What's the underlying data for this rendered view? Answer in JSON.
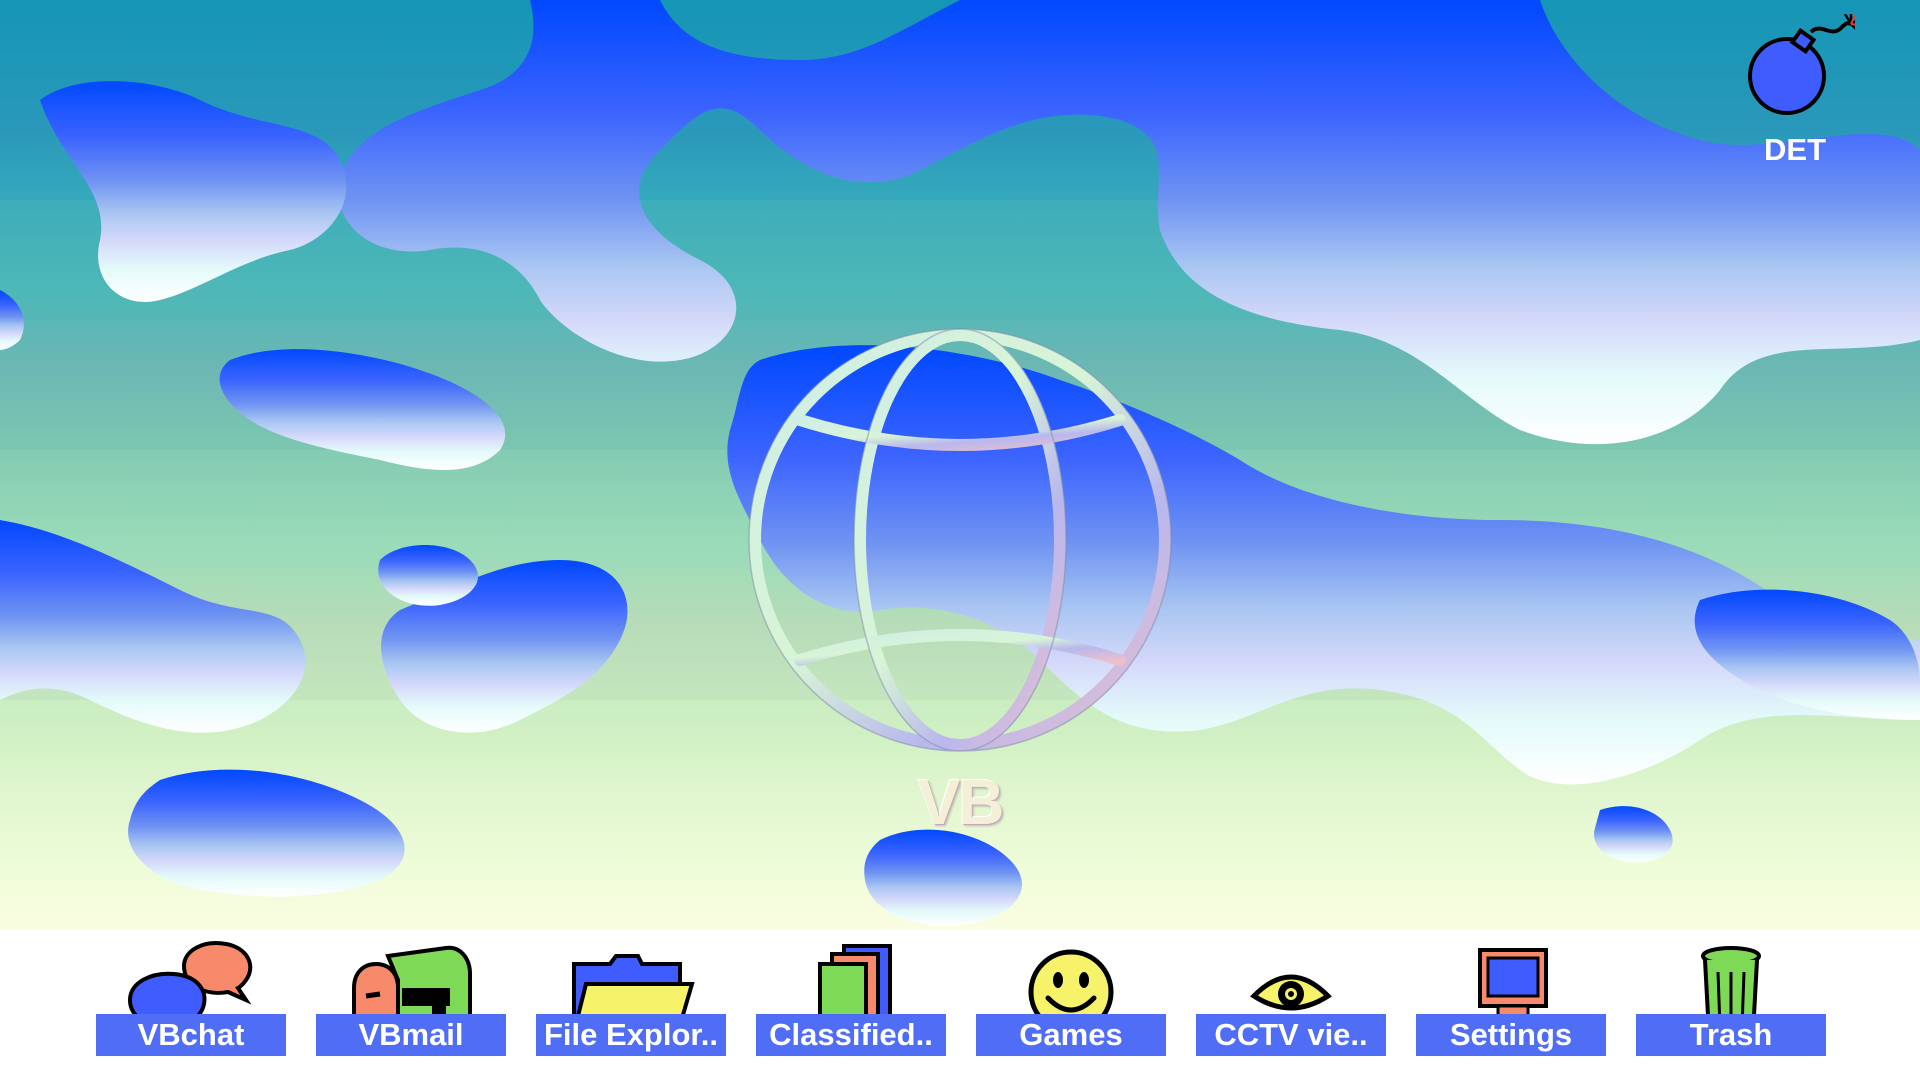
{
  "desktop": {
    "logo_text": "VB",
    "detonate": {
      "label": "DET",
      "icon": "bomb-icon"
    },
    "icons": [
      {
        "label": "VBchat",
        "icon": "chat-bubbles-icon"
      },
      {
        "label": "VBmail",
        "icon": "mailbox-icon"
      },
      {
        "label": "File Explor..",
        "icon": "folder-icon"
      },
      {
        "label": "Classified..",
        "icon": "classified-files-icon"
      },
      {
        "label": "Games",
        "icon": "smiley-icon"
      },
      {
        "label": "CCTV vie..",
        "icon": "eye-icon"
      },
      {
        "label": "Settings",
        "icon": "computer-icon"
      },
      {
        "label": "Trash",
        "icon": "trash-can-icon"
      }
    ]
  },
  "colors": {
    "label_bg": "#4f6ef5",
    "label_text": "#ffffff",
    "wallpaper_blobs": "#3f5cff"
  }
}
